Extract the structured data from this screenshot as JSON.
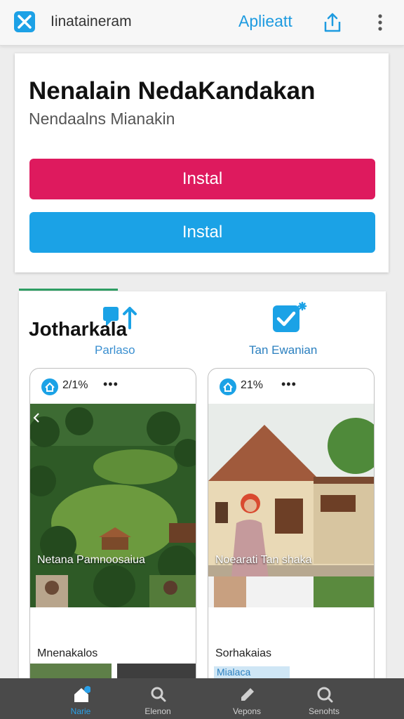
{
  "top_bar": {
    "title": "Iinataineram",
    "link_label": "Aplieatt"
  },
  "app": {
    "name": "Nenalain NedaKandakan",
    "subtitle": "Nendaalns Mianakin"
  },
  "buttons": {
    "primary_label": "Instal",
    "secondary_label": "Instal"
  },
  "section": {
    "title": "Jotharkala",
    "tabs": [
      {
        "label": "Parlaso"
      },
      {
        "label": "Tan Ewanian"
      }
    ]
  },
  "screenshots": [
    {
      "status_pct": "2/1%",
      "dots": "•••",
      "caption": "Netana Pamnoosaiua",
      "bottom_label": "Mnenakalos"
    },
    {
      "status_pct": "21%",
      "dots": "•••",
      "caption": "Noearati Tan shaka",
      "bottom_label": "Sorhakaias",
      "sub_label": "Mialaca"
    }
  ],
  "bottom_nav": [
    {
      "label": "Narie",
      "icon": "home-icon",
      "active": true
    },
    {
      "label": "Elenon",
      "icon": "search-icon",
      "active": false
    },
    {
      "label": "Vepons",
      "icon": "edit-icon",
      "active": false
    },
    {
      "label": "Senohts",
      "icon": "search-icon",
      "active": false
    }
  ],
  "colors": {
    "accent_blue": "#1ba2e6",
    "accent_pink": "#de1a5e",
    "nav_bg": "#4a4a4a"
  }
}
